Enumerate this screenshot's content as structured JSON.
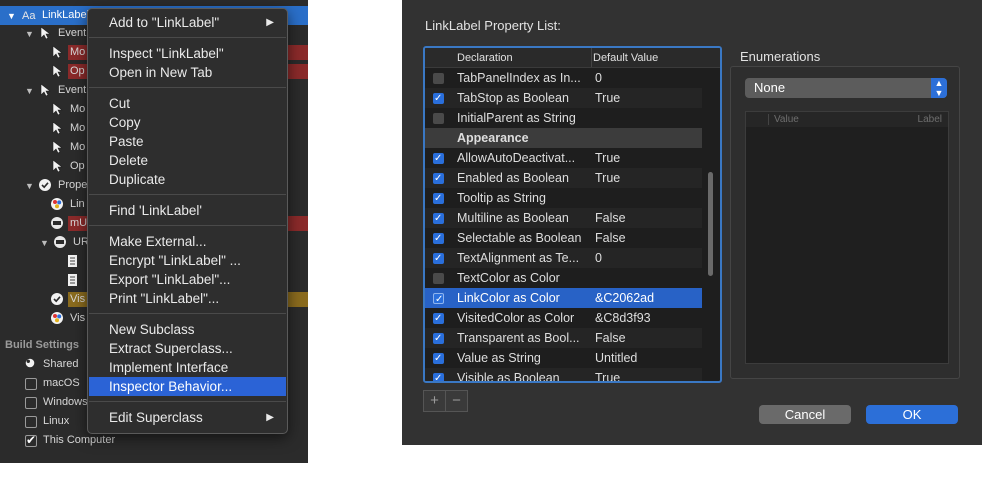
{
  "navigator": {
    "rows": [
      {
        "label": "LinkLabel",
        "kind": "selected",
        "icon": "aa-icon"
      },
      {
        "label": "Event",
        "kind": "tree",
        "icon": "cursor-icon"
      },
      {
        "label": "Mo",
        "kind": "tag-red",
        "icon": "cursor-icon"
      },
      {
        "label": "Op",
        "kind": "tag-red",
        "icon": "cursor-icon"
      },
      {
        "label": "Event",
        "kind": "tree",
        "icon": "cursor-icon"
      },
      {
        "label": "Mo",
        "kind": "plain",
        "icon": "cursor-icon"
      },
      {
        "label": "Mo",
        "kind": "plain",
        "icon": "cursor-icon"
      },
      {
        "label": "Mo",
        "kind": "plain",
        "icon": "cursor-icon"
      },
      {
        "label": "Op",
        "kind": "plain",
        "icon": "cursor-icon"
      },
      {
        "label": "Prope",
        "kind": "tree",
        "icon": "check-circle-icon"
      },
      {
        "label": "Lin",
        "kind": "plain",
        "icon": "color-wheel-icon"
      },
      {
        "label": "mU",
        "kind": "bar-red",
        "icon": "url-icon"
      },
      {
        "label": "UR",
        "kind": "tree",
        "icon": "url-icon"
      },
      {
        "label": "",
        "kind": "plain",
        "icon": "document-icon"
      },
      {
        "label": "",
        "kind": "plain",
        "icon": "document-icon"
      },
      {
        "label": "Vis",
        "kind": "bar-gold",
        "icon": "check-circle-icon"
      },
      {
        "label": "Vis",
        "kind": "plain",
        "icon": "color-wheel-icon"
      }
    ],
    "build_settings_label": "Build Settings",
    "build_items": [
      {
        "label": "Shared",
        "checkbox": "none"
      },
      {
        "label": "macOS",
        "checkbox": "off"
      },
      {
        "label": "Windows",
        "checkbox": "off"
      },
      {
        "label": "Linux",
        "checkbox": "off"
      },
      {
        "label": "This Computer",
        "checkbox": "on"
      }
    ]
  },
  "context_menu": {
    "items": [
      {
        "label": "Add to \"LinkLabel\"",
        "submenu": true
      },
      {
        "sep": true
      },
      {
        "label": "Inspect \"LinkLabel\""
      },
      {
        "label": "Open in New Tab"
      },
      {
        "sep": true
      },
      {
        "label": "Cut"
      },
      {
        "label": "Copy"
      },
      {
        "label": "Paste"
      },
      {
        "label": "Delete"
      },
      {
        "label": "Duplicate"
      },
      {
        "sep": true
      },
      {
        "label": "Find 'LinkLabel'"
      },
      {
        "sep": true
      },
      {
        "label": "Make External..."
      },
      {
        "label": "Encrypt \"LinkLabel\"  ..."
      },
      {
        "label": "Export \"LinkLabel\"..."
      },
      {
        "label": "Print \"LinkLabel\"..."
      },
      {
        "sep": true
      },
      {
        "label": "New Subclass"
      },
      {
        "label": "Extract Superclass..."
      },
      {
        "label": "Implement Interface"
      },
      {
        "label": "Inspector Behavior...",
        "highlighted": true
      },
      {
        "sep": true
      },
      {
        "label": "Edit Superclass",
        "submenu": true
      }
    ],
    "submenu_arrow": "▶"
  },
  "dialog": {
    "title": "LinkLabel Property List:",
    "columns": {
      "declaration": "Declaration",
      "default_value": "Default Value"
    },
    "rows": [
      {
        "checked": false,
        "declaration": "TabPanelIndex as In...",
        "value": "0"
      },
      {
        "checked": true,
        "declaration": "TabStop as Boolean",
        "value": "True"
      },
      {
        "checked": false,
        "declaration": "InitialParent as String",
        "value": ""
      },
      {
        "group": true,
        "declaration": "Appearance",
        "value": ""
      },
      {
        "checked": true,
        "declaration": "AllowAutoDeactivat...",
        "value": "True"
      },
      {
        "checked": true,
        "declaration": "Enabled as Boolean",
        "value": "True"
      },
      {
        "checked": true,
        "declaration": "Tooltip as String",
        "value": ""
      },
      {
        "checked": true,
        "declaration": "Multiline as Boolean",
        "value": "False"
      },
      {
        "checked": true,
        "declaration": "Selectable as Boolean",
        "value": "False"
      },
      {
        "checked": true,
        "declaration": "TextAlignment as Te...",
        "value": "0"
      },
      {
        "checked": false,
        "declaration": "TextColor as Color",
        "value": ""
      },
      {
        "checked": true,
        "declaration": "LinkColor as Color",
        "value": "&C2062ad",
        "selected": true
      },
      {
        "checked": true,
        "declaration": "VisitedColor as Color",
        "value": "&C8d3f93"
      },
      {
        "checked": true,
        "declaration": "Transparent as Bool...",
        "value": "False"
      },
      {
        "checked": true,
        "declaration": "Value as String",
        "value": "Untitled"
      },
      {
        "checked": true,
        "declaration": "Visible as Boolean",
        "value": "True"
      }
    ],
    "add_label": "+",
    "remove_label": "−",
    "enumerations_label": "Enumerations",
    "enum_select_value": "None",
    "enum_columns": {
      "value": "Value",
      "label": "Label"
    },
    "cancel_label": "Cancel",
    "ok_label": "OK"
  },
  "colors": {
    "selection_blue": "#2862c6",
    "accent_blue": "#2c6fd8",
    "dialog_bg": "#323232",
    "menu_bg": "#2e2e2e"
  }
}
